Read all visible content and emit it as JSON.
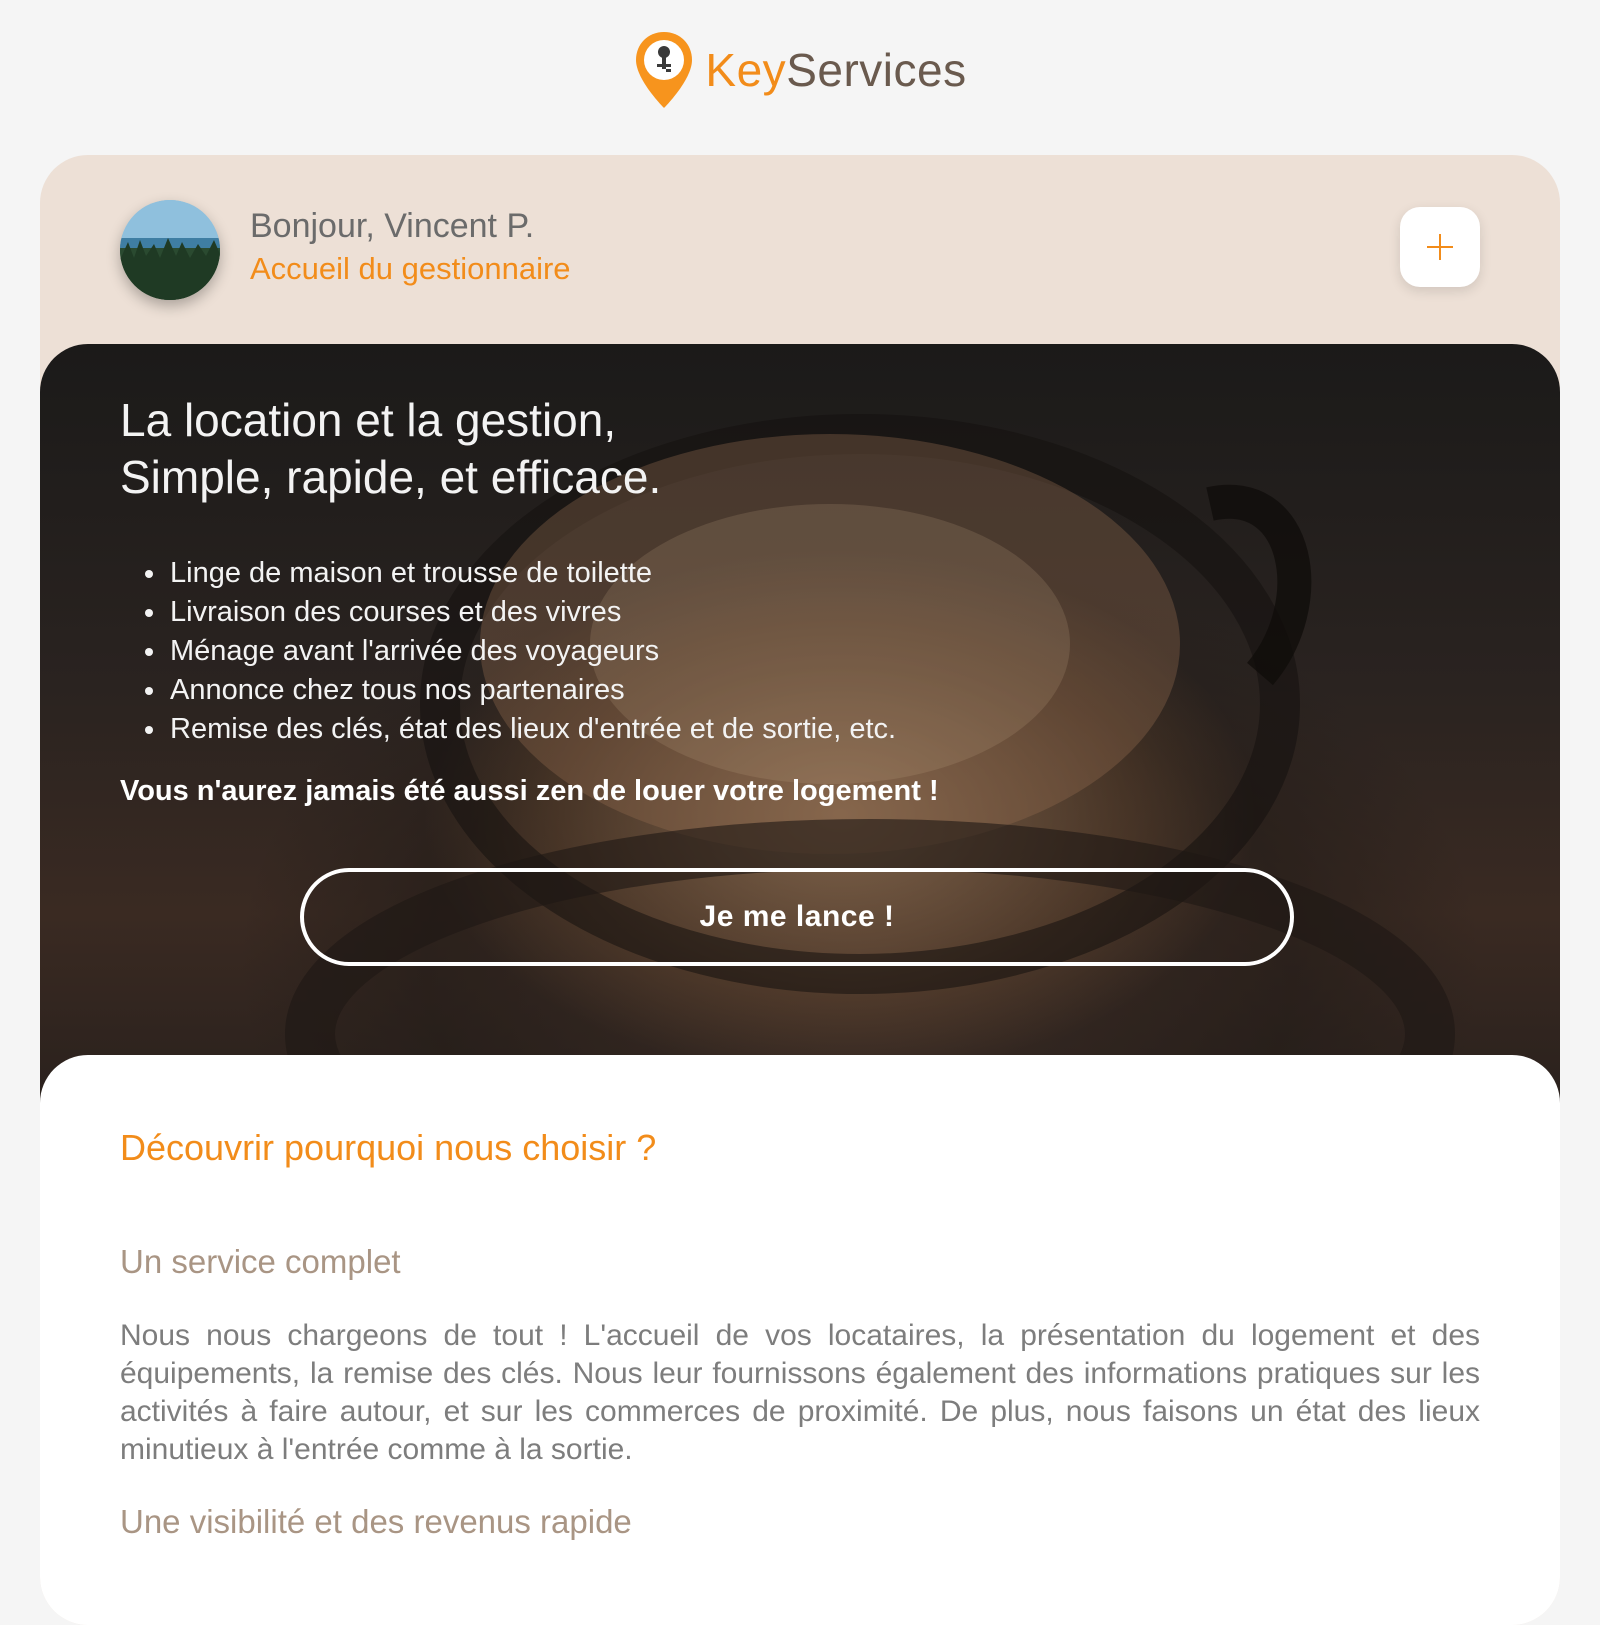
{
  "brand": {
    "name_part1": "Key",
    "name_part2": "Services",
    "accent": "#f28c1a",
    "text_color": "#6a5a4e"
  },
  "header": {
    "greeting": "Bonjour, Vincent P.",
    "subtitle": "Accueil du gestionnaire",
    "add_icon": "plus-icon"
  },
  "hero": {
    "title_line1": "La location et la gestion,",
    "title_line2": "Simple, rapide, et efficace.",
    "items": [
      "Linge de maison et trousse de toilette",
      "Livraison des courses et des vivres",
      "Ménage avant l'arrivée des voyageurs",
      "Annonce chez tous nos partenaires",
      "Remise des clés, état des lieux d'entrée et de sortie, etc."
    ],
    "tagline": "Vous n'aurez jamais été aussi zen de louer votre logement !",
    "cta_label": "Je me lance !"
  },
  "content": {
    "section_title": "Découvrir pourquoi nous choisir ?",
    "features": [
      {
        "title": "Un service complet",
        "body": "Nous nous chargeons de tout ! L'accueil de vos locataires, la présentation du logement et des équipements, la remise des clés. Nous leur fournissons également des informations pratiques sur les activités à faire autour, et sur les commerces de proximité. De plus, nous faisons un état des lieux minutieux à l'entrée comme à la sortie."
      },
      {
        "title": "Une visibilité et des revenus rapide"
      }
    ]
  },
  "colors": {
    "page_bg": "#f5f5f5",
    "card_bg": "#ede0d6",
    "orange": "#f28c1a",
    "muted_heading": "#a99584",
    "body_text": "#7d7d7d"
  }
}
